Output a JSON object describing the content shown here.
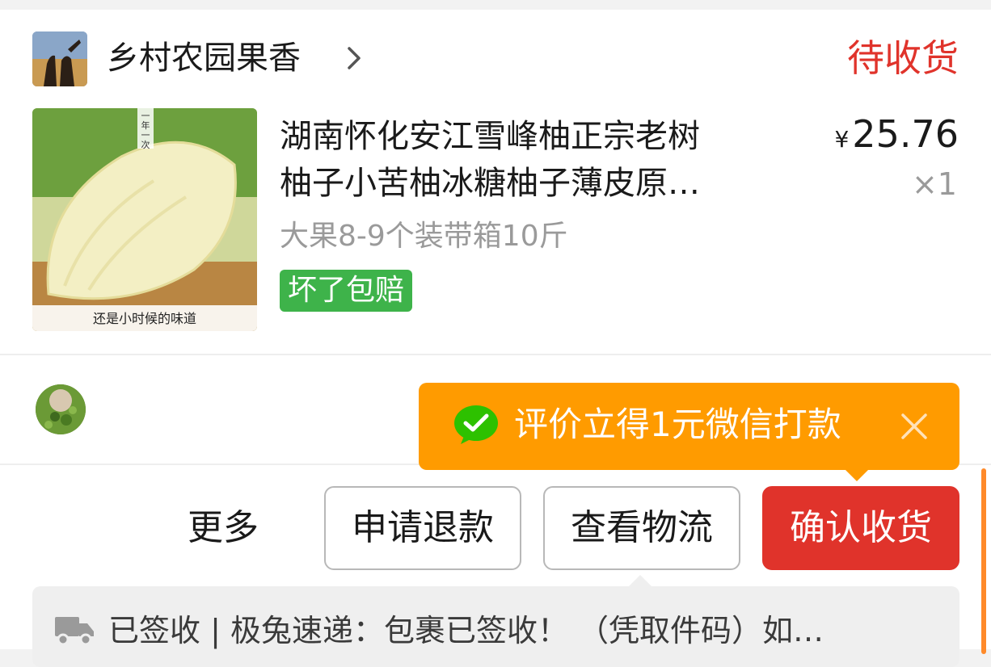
{
  "shop": {
    "name": "乡村农园果香",
    "status": "待收货"
  },
  "product": {
    "title": "湖南怀化安江雪峰柚正宗老树\n柚子小苦柚冰糖柚子薄皮原…",
    "price_symbol": "¥",
    "price": "25.76",
    "quantity": "×1",
    "spec": "大果8-9个装带箱10斤",
    "tag": "坏了包赔",
    "image_caption": "还是小时候的味道",
    "image_badge": "一年一次"
  },
  "promo": {
    "text": "评价立得1元微信打款"
  },
  "actions": {
    "more": "更多",
    "refund": "申请退款",
    "logistics": "查看物流",
    "confirm": "确认收货"
  },
  "logistics_status": {
    "text": "已签收 | 极兔速递：包裹已签收！ （凭取件码）如…"
  },
  "colors": {
    "status_red": "#e0332b",
    "promo_orange": "#ff9b00",
    "tag_green": "#3eb34a",
    "wechat_green": "#2dc100"
  },
  "icons": {
    "shop_chevron": "chevron-right-icon",
    "promo_wechat": "wechat-icon",
    "promo_close": "close-icon",
    "logistics_truck": "truck-icon"
  }
}
